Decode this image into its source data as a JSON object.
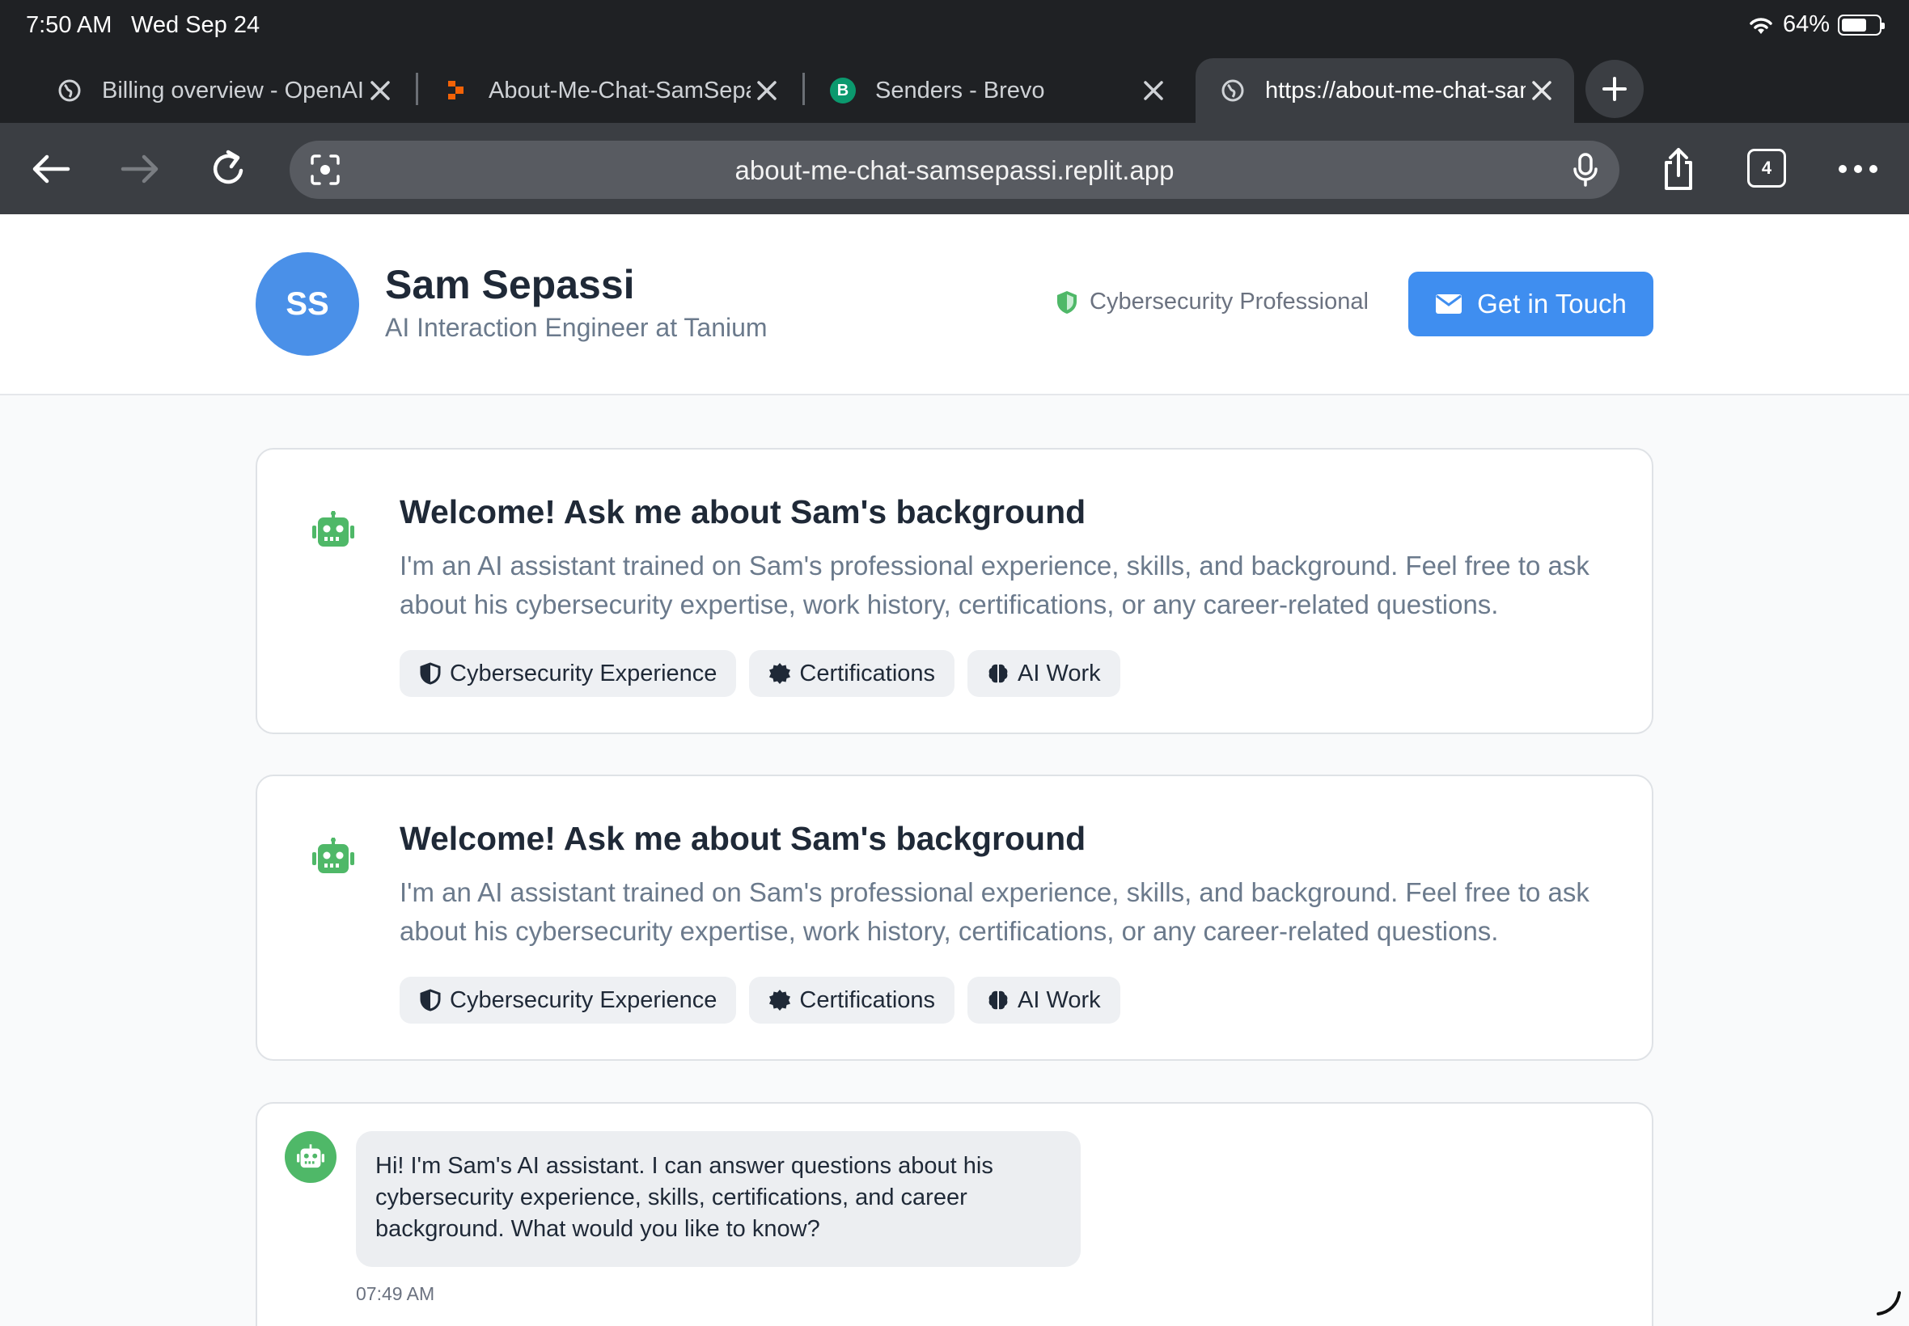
{
  "status": {
    "time": "7:50 AM",
    "date": "Wed Sep 24",
    "battery": "64%"
  },
  "tabs": [
    {
      "title": "Billing overview - OpenAI"
    },
    {
      "title": "About-Me-Chat-SamSepassi"
    },
    {
      "title": "Senders - Brevo",
      "favicon_letter": "B"
    },
    {
      "title": "https://about-me-chat-samsepassi.replit.app"
    }
  ],
  "toolbar": {
    "url": "about-me-chat-samsepassi.replit.app",
    "tab_count": "4"
  },
  "profile": {
    "initials": "SS",
    "name": "Sam Sepassi",
    "role": "AI Interaction Engineer at Tanium",
    "badge": "Cybersecurity Professional",
    "contact_label": "Get in Touch"
  },
  "welcome_cards": [
    {
      "title": "Welcome! Ask me about Sam's background",
      "description": "I'm an AI assistant trained on Sam's professional experience, skills, and background. Feel free to ask about his cybersecurity expertise, work history, certifications, or any career-related questions.",
      "chips": [
        "Cybersecurity Experience",
        "Certifications",
        "AI Work"
      ]
    },
    {
      "title": "Welcome! Ask me about Sam's background",
      "description": "I'm an AI assistant trained on Sam's professional experience, skills, and background. Feel free to ask about his cybersecurity expertise, work history, certifications, or any career-related questions.",
      "chips": [
        "Cybersecurity Experience",
        "Certifications",
        "AI Work"
      ]
    }
  ],
  "chat": {
    "message": "Hi! I'm Sam's AI assistant. I can answer questions about his cybersecurity experience, skills, certifications, and career background. What would you like to know?",
    "time": "07:49 AM"
  },
  "colors": {
    "accent": "#3f8ef0",
    "bot_green": "#4fb868",
    "chrome_bg": "#1f2124"
  }
}
